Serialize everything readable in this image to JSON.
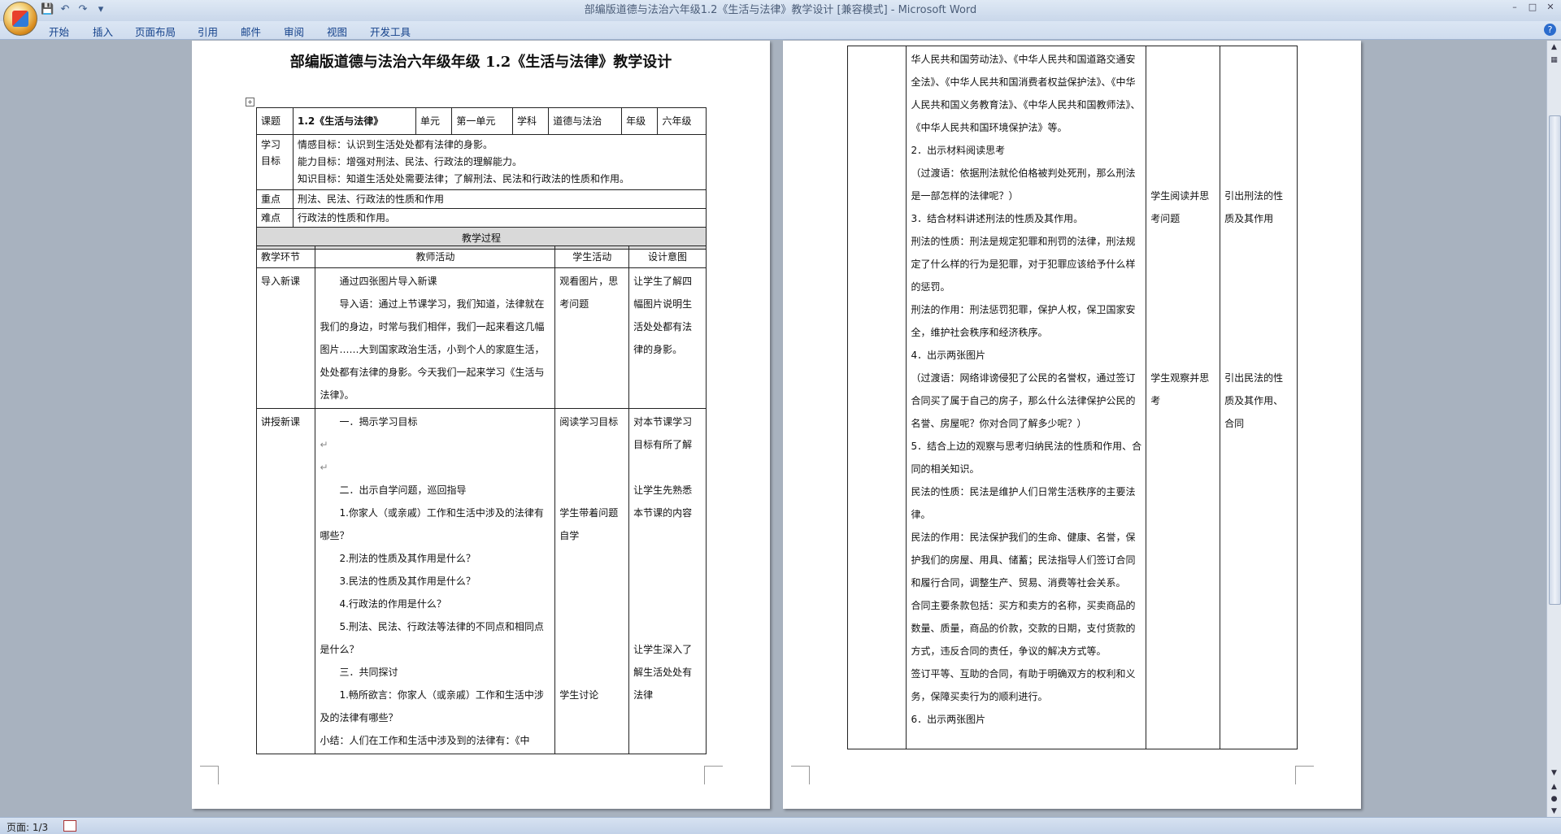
{
  "window": {
    "title": "部编版道德与法治六年级1.2《生活与法律》教学设计 [兼容模式] - Microsoft Word"
  },
  "qat": {
    "save_icon": "save-icon",
    "undo_icon": "undo-icon",
    "redo_icon": "redo-icon",
    "customize_icon": "dropdown-icon"
  },
  "ribbon": {
    "tabs": [
      "开始",
      "插入",
      "页面布局",
      "引用",
      "邮件",
      "审阅",
      "视图",
      "开发工具"
    ]
  },
  "document": {
    "heading": "部编版道德与法治六年级年级 1.2《生活与法律》教学设计",
    "info": {
      "topic_label": "课题",
      "topic_value": "1.2《生活与法律》",
      "unit_label": "单元",
      "unit_value": "第一单元",
      "subject_label": "学科",
      "subject_value": "道德与法治",
      "grade_label": "年级",
      "grade_value": "六年级"
    },
    "goals_label": "学习目标",
    "goals": [
      "情感目标：认识到生活处处都有法律的身影。",
      "能力目标：增强对刑法、民法、行政法的理解能力。",
      "知识目标：知道生活处处需要法律；了解刑法、民法和行政法的性质和作用。"
    ],
    "key_label": "重点",
    "key_value": "刑法、民法、行政法的性质和作用",
    "difficulty_label": "难点",
    "difficulty_value": "行政法的性质和作用。",
    "process_label": "教学过程",
    "headers": [
      "教学环节",
      "教师活动",
      "学生活动",
      "设计意图"
    ],
    "intro": {
      "stage": "导入新课",
      "teacher": [
        "通过四张图片导入新课",
        "导入语：通过上节课学习，我们知道，法律就在我们的身边，时常与我们相伴，我们一起来看这几幅图片……大到国家政治生活，小到个人的家庭生活，处处都有法律的身影。今天我们一起来学习《生活与法律》。"
      ],
      "student": "观看图片，思考问题",
      "intent": "让学生了解四幅图片说明生活处处都有法律的身影。"
    },
    "lecture": {
      "stage": "讲授新课",
      "teacher": [
        "一．揭示学习目标",
        "",
        "",
        "二．出示自学问题，巡回指导",
        "1.你家人（或亲戚）工作和生活中涉及的法律有哪些？",
        "2.刑法的性质及其作用是什么？",
        "3.民法的性质及其作用是什么？",
        "4.行政法的作用是什么？",
        "5.刑法、民法、行政法等法律的不同点和相同点是什么？",
        "三．共同探讨",
        "1.畅所欲言：你家人（或亲戚）工作和生活中涉及的法律有哪些？",
        "小结：人们在工作和生活中涉及到的法律有：《中"
      ],
      "student": [
        "阅读学习目标",
        "",
        "",
        "",
        "学生带着问题自学",
        "",
        "",
        "",
        "",
        "",
        "",
        "",
        "",
        "学生讨论",
        ""
      ],
      "intent": [
        "对本节课学习目标有所了解",
        "",
        "",
        "",
        "让学生先熟悉本节课的内容",
        "",
        "",
        "",
        "",
        "",
        "",
        "",
        "",
        "让学生深入了解生活处处有法律"
      ]
    },
    "page2": {
      "teacher": [
        "华人民共和国劳动法》、《中华人民共和国道路交通安全法》、《中华人民共和国消费者权益保护法》、《中华人民共和国义务教育法》、《中华人民共和国教师法》、《中华人民共和国环境保护法》等。",
        "2．出示材料阅读思考",
        "（过渡语：依据刑法就伦伯格被判处死刑，那么刑法是一部怎样的法律呢？）",
        "3．结合材料讲述刑法的性质及其作用。",
        "刑法的性质：刑法是规定犯罪和刑罚的法律，刑法规定了什么样的行为是犯罪，对于犯罪应该给予什么样的惩罚。",
        "刑法的作用：刑法惩罚犯罪，保护人权，保卫国家安全，维护社会秩序和经济秩序。",
        "4．出示两张图片",
        "（过渡语：网络诽谤侵犯了公民的名誉权，通过签订合同买了属于自己的房子，那么什么法律保护公民的名誉、房屋呢？你对合同了解多少呢？）",
        "5．结合上边的观察与思考归纳民法的性质和作用、合同的相关知识。",
        "民法的性质：民法是维护人们日常生活秩序的主要法律。",
        "民法的作用：民法保护我们的生命、健康、名誉，保护我们的房屋、用具、储蓄；民法指导人们签订合同和履行合同，调整生产、贸易、消费等社会关系。",
        "合同主要条款包括：买方和卖方的名称，买卖商品的数量、质量，商品的价款，交款的日期，支付货款的方式，违反合同的责任，争议的解决方式等。",
        "签订平等、互助的合同，有助于明确双方的权利和义务，保障买卖行为的顺利进行。",
        "6．出示两张图片"
      ],
      "student_a": "学生阅读并思考问题",
      "intent_a": "引出刑法的性质及其作用",
      "student_b": "学生观察并思考",
      "intent_b": "引出民法的性质及其作用、合同"
    }
  },
  "status": {
    "page_count": "页面: 1/3"
  }
}
